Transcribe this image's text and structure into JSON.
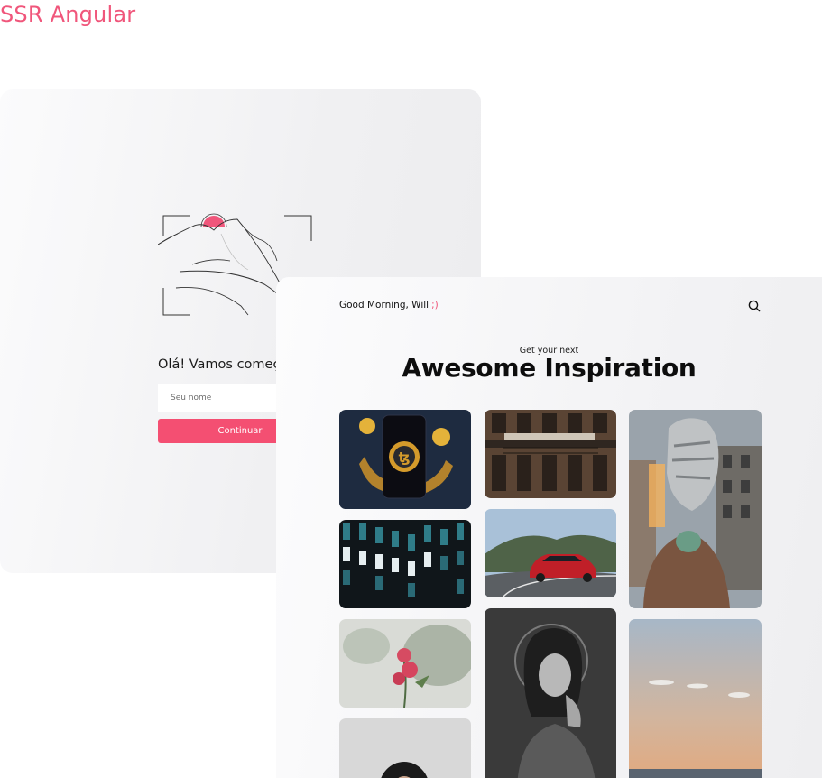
{
  "page": {
    "title": "SSR Angular"
  },
  "login": {
    "greeting": "Olá! Vamos começ",
    "name_placeholder": "Seu nome",
    "continue_label": "Continuar"
  },
  "gallery": {
    "greeting": "Good Morning, Will",
    "greeting_emoticon": ";)",
    "subtitle": "Get your next",
    "headline": "Awesome Inspiration",
    "icons": {
      "search": "search-icon"
    },
    "images": [
      {
        "name": "tezos-coin-phone-image"
      },
      {
        "name": "building-balcony-image"
      },
      {
        "name": "metal-head-sculpture-image"
      },
      {
        "name": "glass-facade-image"
      },
      {
        "name": "red-car-road-image"
      },
      {
        "name": "pink-flowers-image"
      },
      {
        "name": "woman-portrait-bw-image"
      },
      {
        "name": "sunset-sky-image"
      },
      {
        "name": "woman-portrait-image"
      }
    ]
  },
  "colors": {
    "accent": "#f0567b",
    "button": "#f44f72",
    "text": "#111111"
  }
}
